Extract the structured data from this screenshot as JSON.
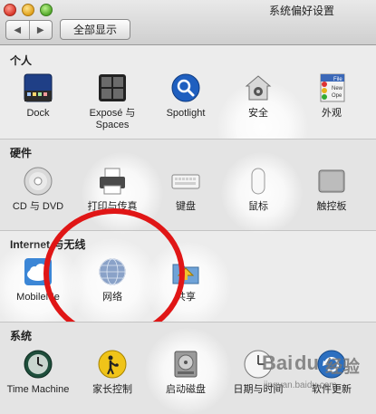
{
  "window": {
    "title": "系统偏好设置"
  },
  "toolbar": {
    "back_glyph": "◀",
    "forward_glyph": "▶",
    "show_all_label": "全部显示"
  },
  "sections": {
    "personal": {
      "title": "个人",
      "items": [
        {
          "label": "Dock",
          "icon": "dock-icon"
        },
        {
          "label": "Exposé 与 Spaces",
          "icon": "expose-spaces-icon"
        },
        {
          "label": "Spotlight",
          "icon": "spotlight-icon"
        },
        {
          "label": "安全",
          "icon": "security-house-icon"
        },
        {
          "label": "外观",
          "icon": "appearance-icon"
        }
      ]
    },
    "hardware": {
      "title": "硬件",
      "items": [
        {
          "label": "CD 与 DVD",
          "icon": "cd-dvd-icon"
        },
        {
          "label": "打印与传真",
          "icon": "printer-icon"
        },
        {
          "label": "键盘",
          "icon": "keyboard-icon"
        },
        {
          "label": "鼠标",
          "icon": "mouse-icon"
        },
        {
          "label": "触控板",
          "icon": "trackpad-icon"
        }
      ]
    },
    "internet": {
      "title": "Internet 与无线",
      "items": [
        {
          "label": "MobileMe",
          "icon": "mobileme-cloud-icon"
        },
        {
          "label": "网络",
          "icon": "network-globe-icon"
        },
        {
          "label": "共享",
          "icon": "sharing-folder-icon"
        }
      ]
    },
    "system": {
      "title": "系统",
      "items": [
        {
          "label": "Time Machine",
          "icon": "time-machine-icon"
        },
        {
          "label": "家长控制",
          "icon": "parental-controls-icon"
        },
        {
          "label": "启动磁盘",
          "icon": "startup-disk-icon"
        },
        {
          "label": "日期与时间",
          "icon": "date-time-clock-icon"
        },
        {
          "label": "软件更新",
          "icon": "software-update-icon"
        }
      ]
    }
  },
  "appearance_icon_text": {
    "file": "File",
    "new": "New",
    "open": "Ope"
  },
  "watermark": {
    "brand": "Bai",
    "brand_paw": "du",
    "product": "经验",
    "url": "jingyan.baidu.com"
  },
  "colors": {
    "highlight_circle": "#e01616"
  }
}
